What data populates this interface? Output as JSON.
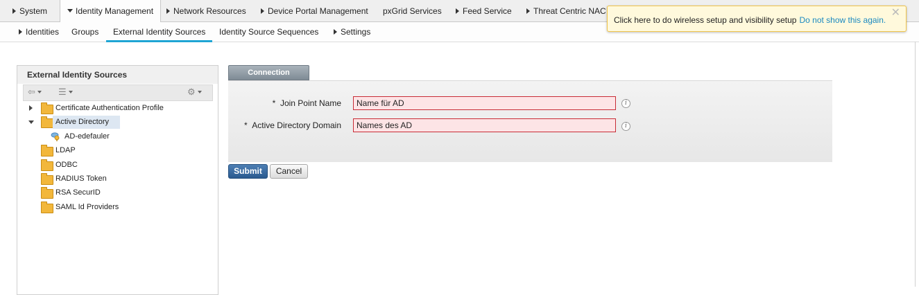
{
  "top_tabs": [
    {
      "label": "System",
      "state": "collapsed"
    },
    {
      "label": "Identity Management",
      "state": "expanded"
    },
    {
      "label": "Network Resources",
      "state": "collapsed"
    },
    {
      "label": "Device Portal Management",
      "state": "collapsed"
    },
    {
      "label": "pxGrid Services",
      "state": "none"
    },
    {
      "label": "Feed Service",
      "state": "collapsed"
    },
    {
      "label": "Threat Centric NAC",
      "state": "collapsed"
    }
  ],
  "sub_tabs": [
    {
      "label": "Identities",
      "arrow": true
    },
    {
      "label": "Groups",
      "arrow": false
    },
    {
      "label": "External Identity Sources",
      "arrow": false,
      "active": true
    },
    {
      "label": "Identity Source Sequences",
      "arrow": false
    },
    {
      "label": "Settings",
      "arrow": true
    }
  ],
  "notice": {
    "text": "Click here to do wireless setup and visibility setup",
    "link": "Do not show this again.",
    "close": "✕"
  },
  "sidebar": {
    "title": "External Identity Sources",
    "tree": [
      {
        "label": "Certificate Authentication Profile",
        "expander": "collapsed"
      },
      {
        "label": "Active Directory",
        "expander": "expanded",
        "selected": true
      },
      {
        "label": "AD-edefauler",
        "child": true
      },
      {
        "label": "LDAP"
      },
      {
        "label": "ODBC"
      },
      {
        "label": "RADIUS Token"
      },
      {
        "label": "RSA SecurID"
      },
      {
        "label": "SAML Id Providers"
      }
    ]
  },
  "form": {
    "tab_label": "Connection",
    "required_mark": "*",
    "join_point_label": "Join Point Name",
    "join_point_value": "Name für AD",
    "domain_label": "Active Directory Domain",
    "domain_value": "Names des AD",
    "info_glyph": "i",
    "submit_label": "Submit",
    "cancel_label": "Cancel"
  },
  "colors": {
    "accent": "#1fa5d4",
    "error_border": "#c72b35",
    "error_fill": "#fde4e6",
    "primary_button": "#2a5a8f",
    "notice_bg": "#fff9dc"
  }
}
